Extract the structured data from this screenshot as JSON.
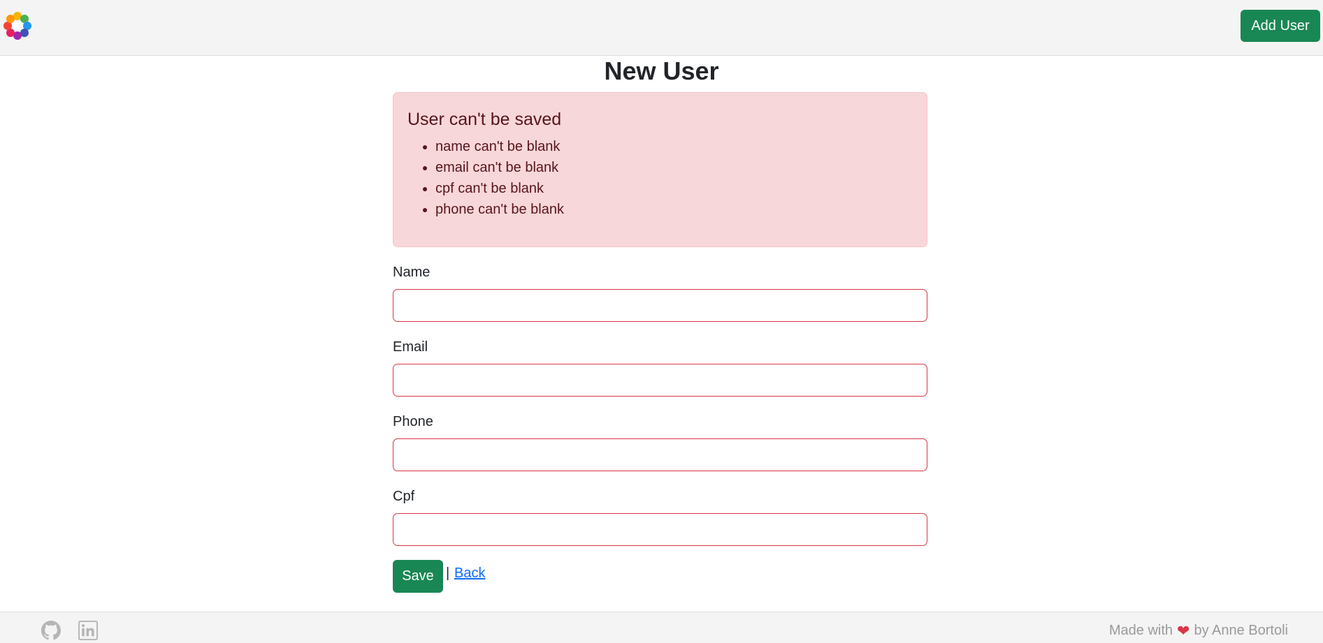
{
  "navbar": {
    "logo_icon": "colorful-flower-logo-icon",
    "add_user_label": "Add User",
    "add_user_color": "#198754"
  },
  "page": {
    "title": "New User"
  },
  "alert": {
    "title": "User can't be saved",
    "errors": [
      "name can't be blank",
      "email can't be blank",
      "cpf can't be blank",
      "phone can't be blank"
    ],
    "background": "#f8d7da",
    "text_color": "#58151c"
  },
  "form": {
    "fields": [
      {
        "label": "Name",
        "value": ""
      },
      {
        "label": "Email",
        "value": ""
      },
      {
        "label": "Phone",
        "value": ""
      },
      {
        "label": "Cpf",
        "value": ""
      }
    ],
    "invalid_border_color": "#dc3545",
    "save_label": "Save",
    "separator": "|",
    "back_label": "Back"
  },
  "footer": {
    "github_icon": "github-icon",
    "linkedin_icon": "linkedin-icon",
    "made_with": "Made with",
    "heart_icon": "heart-icon",
    "by_text": "by Anne Bortoli"
  }
}
